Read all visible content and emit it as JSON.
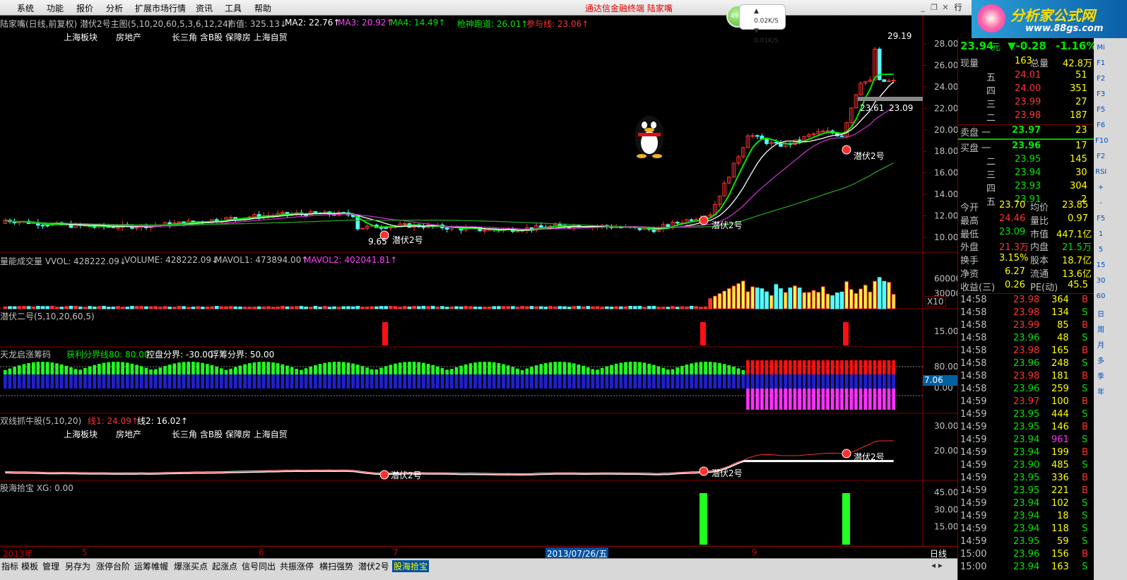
{
  "menu": {
    "items": [
      "系统",
      "功能",
      "报价",
      "分析",
      "扩展市场行情",
      "资讯",
      "工具",
      "帮助"
    ],
    "title": "通达信金融终端  陆家嘴"
  },
  "net": {
    "percent": "49%",
    "up": "0.02K/S",
    "down": "0.01K/S"
  },
  "brand": {
    "title": "分析家公式网",
    "url": "www.88gs.com",
    "tab": "行"
  },
  "main": {
    "header": "陆家嘴(日线,前复权) 潜伏2号主图(5,10,20,60,5,3,6,12,24)",
    "mv": "市值: 325.13↓",
    "ma2": "MA2: 22.76↑",
    "ma3": "MA3: 20.92↑",
    "ma4": "MA4: 14.49↑",
    "qs": "枪神跑道: 26.01↑",
    "cy": "参与线: 23.06↑",
    "tags": [
      "上海板块",
      "房地产",
      "长三角 含B股 保障房 上海自贸"
    ],
    "ann_hi": "29.19",
    "ann_r1": "23.61",
    "ann_r2": "23.09",
    "ann_lo": "9.65",
    "signals": [
      "潜伏2号",
      "潜伏2号",
      "潜伏2号"
    ],
    "yticks": [
      "28.00",
      "26.00",
      "24.00",
      "22.00",
      "20.00",
      "18.00",
      "16.00",
      "14.00",
      "12.00",
      "10.00"
    ]
  },
  "vol": {
    "header": "量能成交量 VVOL: 428222.09↓",
    "v": "VOLUME: 428222.09↓",
    "m1": "MAVOL1: 473894.00↑",
    "m2": "MAVOL2: 402041.81↑",
    "yticks": [
      "60000",
      "30000"
    ],
    "unit": "X10"
  },
  "qf": {
    "header": "潜伏二号(5,10,20,60,5)",
    "ytick": "15.00"
  },
  "tl": {
    "header": "天龙启涨筹码",
    "p1": "获利分界线80: 80.00",
    "p2": "控盘分界: -30.00",
    "p3": "浮筹分界: 50.00",
    "yticks": [
      "80.00",
      "0.00"
    ],
    "value": "7.06"
  },
  "sx": {
    "header": "双线抓牛股(5,10,20)",
    "l1": "线1: 24.09↑",
    "l2": "线2: 16.02↑",
    "tags": [
      "上海板块",
      "房地产",
      "长三角 含B股 保障房 上海自贸"
    ],
    "yticks": [
      "30.00",
      "20.00"
    ],
    "signals": [
      "潜伏2号",
      "潜伏2号",
      "潜伏2号"
    ]
  },
  "gh": {
    "header": "股海拾宝 XG: 0.00",
    "yticks": [
      "45.00",
      "30.00",
      "15.00"
    ]
  },
  "dates": [
    "2013年",
    "5",
    "6",
    "7",
    "2013/07/26/五",
    "9"
  ],
  "tabs": [
    "指标",
    "模板",
    "管理",
    "另存为",
    "涨停台阶",
    "运筹帷幄",
    "爆涨买点",
    "起涨点",
    "信号同出",
    "共振涨停",
    "横扫强势",
    "潜伏2号",
    "股海拾宝"
  ],
  "period": "日线",
  "quote": {
    "price": "23.94",
    "unit": "元",
    "chg": "▼-0.28",
    "pct": "-1.16%",
    "now_l": "现量",
    "now_v": "163",
    "tot_l": "总量",
    "tot_v": "42.8万",
    "sells": [
      [
        "五",
        "24.01",
        "51"
      ],
      [
        "四",
        "24.00",
        "351"
      ],
      [
        "三",
        "23.99",
        "27"
      ],
      [
        "二",
        "23.98",
        "187"
      ]
    ],
    "sell1": [
      "卖盘 一",
      "23.97",
      "23"
    ],
    "buy1": [
      "买盘 一",
      "23.96",
      "17"
    ],
    "buys": [
      [
        "二",
        "23.95",
        "145"
      ],
      [
        "三",
        "23.94",
        "30"
      ],
      [
        "四",
        "23.93",
        "304"
      ],
      [
        "五",
        "23.91",
        "2"
      ]
    ],
    "stats": [
      [
        "今开",
        "23.70",
        "均价",
        "23.85"
      ],
      [
        "最高",
        "24.46",
        "量比",
        "0.97"
      ],
      [
        "最低",
        "23.09",
        "市值",
        "447.1亿"
      ],
      [
        "外盘",
        "21.3万",
        "内盘",
        "21.5万"
      ],
      [
        "换手",
        "3.15%",
        "股本",
        "18.7亿"
      ],
      [
        "净资",
        "6.27",
        "流通",
        "13.6亿"
      ],
      [
        "收益(三)",
        "0.26",
        "PE(动)",
        "45.5"
      ]
    ],
    "ticks": [
      [
        "14:58",
        "23.98",
        "364",
        "B"
      ],
      [
        "14:58",
        "23.98",
        "134",
        "S"
      ],
      [
        "14:58",
        "23.99",
        "85",
        "B"
      ],
      [
        "14:58",
        "23.96",
        "48",
        "S"
      ],
      [
        "14:58",
        "23.98",
        "165",
        "B"
      ],
      [
        "14:58",
        "23.96",
        "248",
        "S"
      ],
      [
        "14:58",
        "23.98",
        "181",
        "B"
      ],
      [
        "14:58",
        "23.96",
        "259",
        "S"
      ],
      [
        "14:59",
        "23.97",
        "100",
        "B"
      ],
      [
        "14:59",
        "23.95",
        "444",
        "S"
      ],
      [
        "14:59",
        "23.95",
        "146",
        "B"
      ],
      [
        "14:59",
        "23.94",
        "961",
        "S"
      ],
      [
        "14:59",
        "23.94",
        "199",
        "B"
      ],
      [
        "14:59",
        "23.90",
        "485",
        "S"
      ],
      [
        "14:59",
        "23.95",
        "336",
        "B"
      ],
      [
        "14:59",
        "23.95",
        "221",
        "B"
      ],
      [
        "14:59",
        "23.94",
        "102",
        "S"
      ],
      [
        "14:59",
        "23.94",
        "18",
        "S"
      ],
      [
        "14:59",
        "23.94",
        "118",
        "S"
      ],
      [
        "14:59",
        "23.95",
        "59",
        "S"
      ],
      [
        "15:00",
        "23.96",
        "156",
        "B"
      ],
      [
        "15:00",
        "23.94",
        "163",
        "S"
      ]
    ]
  },
  "side": [
    "Mi",
    "F1",
    "F2",
    "F3",
    "F5",
    "F6",
    "F10",
    "F2",
    "RSI",
    "+",
    "-",
    "F5",
    "1",
    "5",
    "15",
    "30",
    "60",
    "日",
    "周",
    "月",
    "多",
    "季",
    "年"
  ],
  "colors": {
    "up": "#ff3232",
    "down": "#54ffff",
    "ma_white": "#ffffff",
    "ma_green": "#00e600",
    "ma_pink": "#c030c0",
    "ma_dkgreen": "#20a020",
    "axis": "#800000"
  }
}
